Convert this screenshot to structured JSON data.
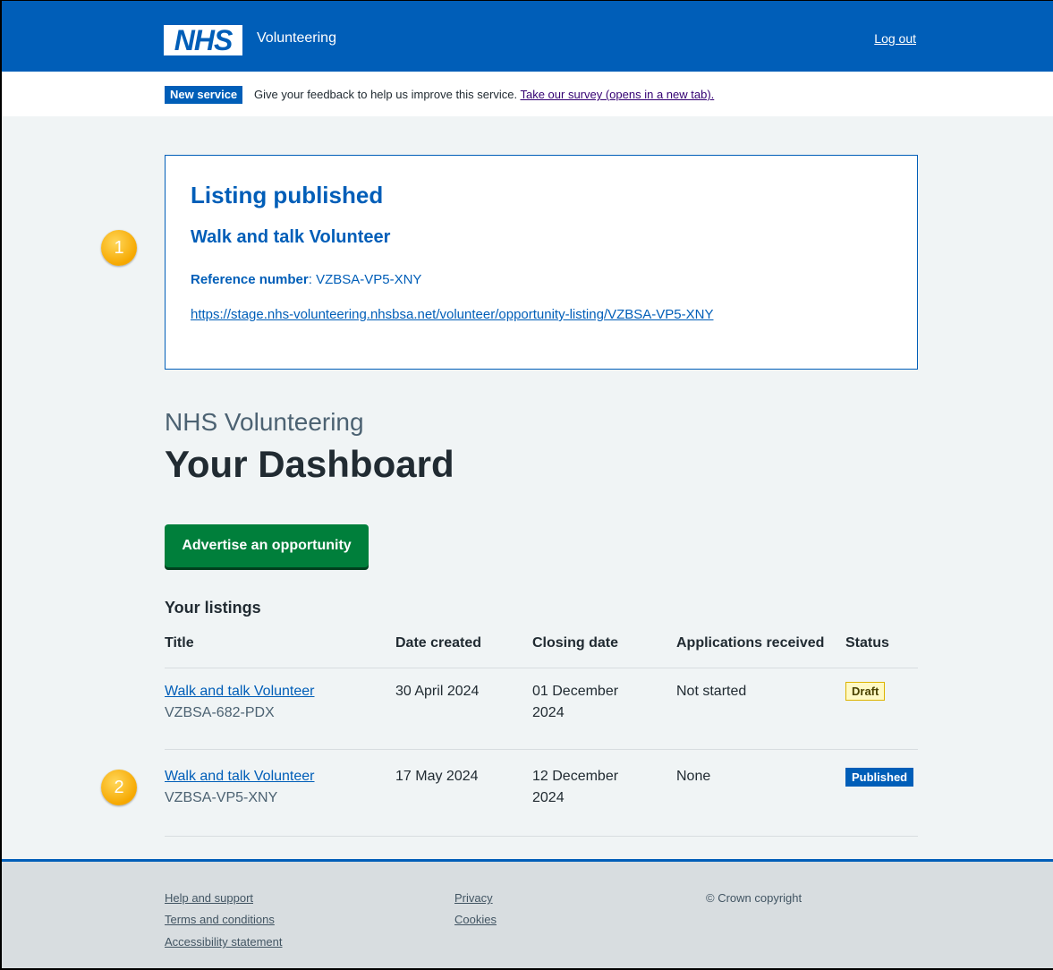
{
  "header": {
    "logo_text": "NHS",
    "service_name": "Volunteering",
    "logout_label": "Log out"
  },
  "banner": {
    "tag": "New service",
    "text": "Give your feedback to help us improve this service.",
    "link": "Take our survey (opens in a new tab)."
  },
  "panel": {
    "title": "Listing published",
    "subtitle": "Walk and talk Volunteer",
    "ref_label": "Reference number",
    "ref_value": "VZBSA-VP5-XNY",
    "url": "https://stage.nhs-volunteering.nhsbsa.net/volunteer/opportunity-listing/VZBSA-VP5-XNY"
  },
  "markers": [
    "1",
    "2"
  ],
  "dashboard": {
    "caption": "NHS Volunteering",
    "heading": "Your Dashboard",
    "advertise_button": "Advertise an opportunity",
    "listings_title": "Your listings",
    "columns": [
      "Title",
      "Date created",
      "Closing date",
      "Applications received",
      "Status"
    ],
    "rows": [
      {
        "title": "Walk and talk Volunteer",
        "ref": "VZBSA-682-PDX",
        "date_created": "30 April 2024",
        "closing_line1": "01 December",
        "closing_line2": "2024",
        "applications": "Not started",
        "status": "Draft"
      },
      {
        "title": "Walk and talk Volunteer",
        "ref": "VZBSA-VP5-XNY",
        "date_created": "17 May 2024",
        "closing_line1": "12 December",
        "closing_line2": "2024",
        "applications": "None",
        "status": "Published"
      }
    ]
  },
  "footer": {
    "links_col1": [
      "Help and support",
      "Terms and conditions",
      "Accessibility statement"
    ],
    "links_col2": [
      "Privacy",
      "Cookies"
    ],
    "copyright": "© Crown copyright"
  },
  "colors": {
    "nhs_blue": "#005eb8",
    "button_green": "#007f3b",
    "page_bg": "#f0f4f5",
    "marker_orange": "#f6a800"
  }
}
